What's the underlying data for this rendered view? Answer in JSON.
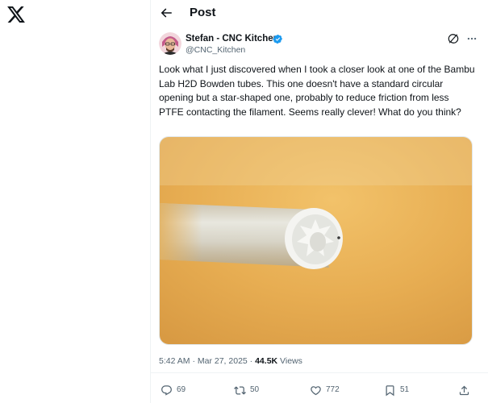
{
  "header": {
    "title": "Post"
  },
  "tweet": {
    "author_name": "Stefan - CNC Kitchen",
    "handle": "@CNC_Kitchen",
    "text": "Look what I just discovered when I took a closer look at one of the Bambu Lab H2D Bowden tubes. This one doesn't have a standard circular opening but a star-shaped one, probably to reduce friction from less PTFE contacting the filament. Seems really clever! What do you think?",
    "time": "5:42 AM",
    "date": "Mar 27, 2025",
    "separator": "·",
    "views": "44.5K",
    "views_label": "Views"
  },
  "actions": {
    "replies": "69",
    "reposts": "50",
    "likes": "772",
    "bookmarks": "51"
  },
  "icons": {
    "logo": "x-logo-icon",
    "back": "back-arrow-icon",
    "verified": "verified-badge-icon",
    "grok": "grok-icon",
    "reply": "reply-icon",
    "repost": "repost-icon",
    "like": "heart-icon",
    "bookmark": "bookmark-icon",
    "share": "share-icon"
  },
  "colors": {
    "text": "#0f1419",
    "secondary": "#536471",
    "verified": "#1d9bf0",
    "divider": "#eff3f4"
  }
}
